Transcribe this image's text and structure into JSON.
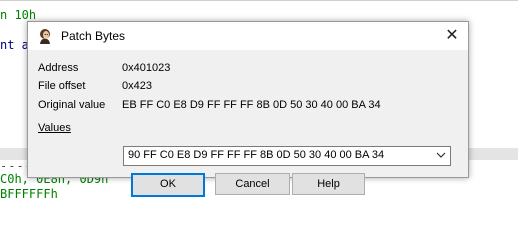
{
  "background": {
    "line1": "n 10h",
    "line2": "nt a",
    "line3": "C0h, 0E8h, 0D9h",
    "line4": "BFFFFFFh",
    "dashes": "--------"
  },
  "dialog": {
    "title": "Patch Bytes",
    "icon": "ida-app-icon",
    "close_glyph": "✕",
    "fields": {
      "address_label": "Address",
      "address_value": "0x401023",
      "file_offset_label": "File offset",
      "file_offset_value": "0x423",
      "original_label": "Original value",
      "original_value": "EB FF C0 E8 D9 FF FF FF 8B 0D 50 30 40 00 BA 34",
      "values_label": "Values",
      "values_value": "90 FF C0 E8 D9 FF FF FF 8B 0D 50 30 40 00 BA 34"
    },
    "buttons": {
      "ok": "OK",
      "cancel": "Cancel",
      "help": "Help"
    }
  },
  "colors": {
    "accent": "#0078d7",
    "dialog_bg": "#f0f0f0",
    "code_green": "#008000",
    "code_blue": "#00007f"
  }
}
